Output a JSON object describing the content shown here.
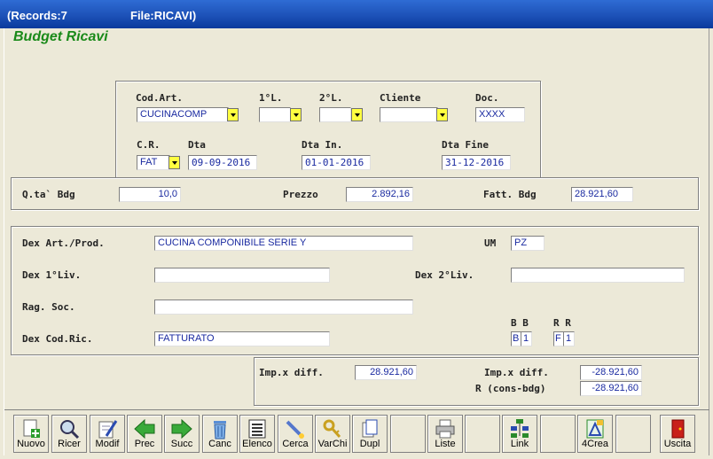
{
  "titlebar": {
    "records": "(Records:7",
    "file": "File:RICAVI)"
  },
  "app_title": "Budget Ricavi",
  "header": {
    "cod_art": {
      "label": "Cod.Art.",
      "value": "CUCINACOMP"
    },
    "liv1": {
      "label": "1°L.",
      "value": ""
    },
    "liv2": {
      "label": "2°L.",
      "value": ""
    },
    "cliente": {
      "label": "Cliente",
      "value": ""
    },
    "doc": {
      "label": "Doc.",
      "value": "XXXX"
    },
    "cr": {
      "label": "C.R.",
      "value": "FAT"
    },
    "dta": {
      "label": "Dta",
      "value": "09-09-2016"
    },
    "dta_in": {
      "label": "Dta In.",
      "value": "01-01-2016"
    },
    "dta_fine": {
      "label": "Dta Fine",
      "value": "31-12-2016"
    }
  },
  "budget": {
    "qta": {
      "label": "Q.ta` Bdg",
      "value": "10,0"
    },
    "prezzo": {
      "label": "Prezzo",
      "value": "2.892,16"
    },
    "fatt": {
      "label": "Fatt. Bdg",
      "value": "28.921,60"
    }
  },
  "details": {
    "dex_art": {
      "label": "Dex Art./Prod.",
      "value": "CUCINA COMPONIBILE SERIE Y"
    },
    "um": {
      "label": "UM",
      "value": "PZ"
    },
    "dex_1liv": {
      "label": "Dex 1°Liv.",
      "value": ""
    },
    "dex_2liv": {
      "label": "Dex 2°Liv.",
      "value": ""
    },
    "rag_soc": {
      "label": "Rag. Soc.",
      "value": ""
    },
    "dex_cod_ric": {
      "label": "Dex Cod.Ric.",
      "value": "FATTURATO"
    },
    "bb": {
      "label": "B B",
      "v1": "B",
      "v2": "1"
    },
    "rr": {
      "label": "R R",
      "v1": "F",
      "v2": "1"
    }
  },
  "diff": {
    "imp1": {
      "label": "Imp.x diff.",
      "value": "28.921,60"
    },
    "imp2": {
      "label": "Imp.x diff.",
      "value": "-28.921,60"
    },
    "r": {
      "label": "R (cons-bdg)",
      "value": "-28.921,60"
    }
  },
  "toolbar": {
    "nuovo": "Nuovo",
    "ricer": "Ricer",
    "modif": "Modif",
    "prec": "Prec",
    "succ": "Succ",
    "canc": "Canc",
    "elenco": "Elenco",
    "cerca": "Cerca",
    "varchi": "VarChi",
    "dupl": "Dupl",
    "liste": "Liste",
    "link": "Link",
    "crea4": "4Crea",
    "uscita": "Uscita"
  },
  "icons": {
    "nuovo": "new-document-icon",
    "ricer": "magnifier-icon",
    "modif": "edit-document-icon",
    "prec": "arrow-left-icon",
    "succ": "arrow-right-icon",
    "canc": "trash-icon",
    "elenco": "list-icon",
    "cerca": "search-icon",
    "varchi": "keys-icon",
    "dupl": "duplicate-icon",
    "liste": "printer-icon",
    "link": "link-tree-icon",
    "crea4": "create-icon",
    "uscita": "exit-door-icon"
  },
  "colors": {
    "titlebar": "#1b4fb5",
    "title_green": "#1a8a1a",
    "value_blue": "#1a2aa0",
    "combo_yellow": "#ffff40"
  }
}
